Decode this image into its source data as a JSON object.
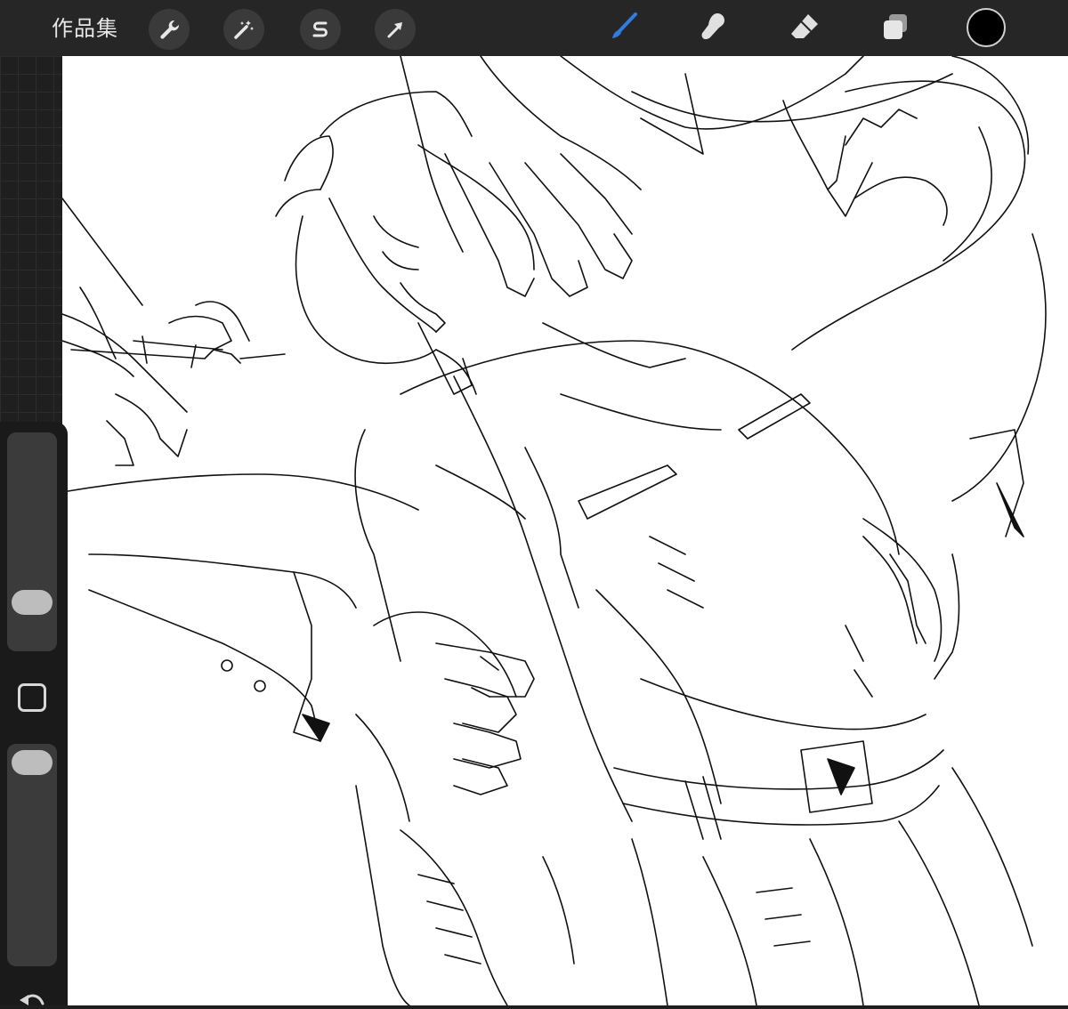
{
  "topbar": {
    "gallery_label": "作品集",
    "left_tools": [
      {
        "name": "actions",
        "icon": "wrench-icon"
      },
      {
        "name": "adjustments",
        "icon": "magic-wand-icon"
      },
      {
        "name": "selection",
        "icon": "selection-s-icon"
      },
      {
        "name": "transform",
        "icon": "arrow-cursor-icon"
      }
    ],
    "right_tools": [
      {
        "name": "brush",
        "icon": "brush-icon",
        "active": true,
        "color": "#2f7de1"
      },
      {
        "name": "smudge",
        "icon": "smudge-finger-icon",
        "active": false
      },
      {
        "name": "eraser",
        "icon": "eraser-icon",
        "active": false
      },
      {
        "name": "layers",
        "icon": "layers-icon",
        "active": false
      }
    ],
    "current_color": "#000000"
  },
  "sidebar": {
    "brush_size_level": 0.15,
    "opacity_level": 0.0,
    "modify_icon": "square-icon",
    "undo_icon": "undo-arrow-icon"
  },
  "canvas": {
    "background": "#ffffff",
    "content": "sketch-artwork"
  }
}
